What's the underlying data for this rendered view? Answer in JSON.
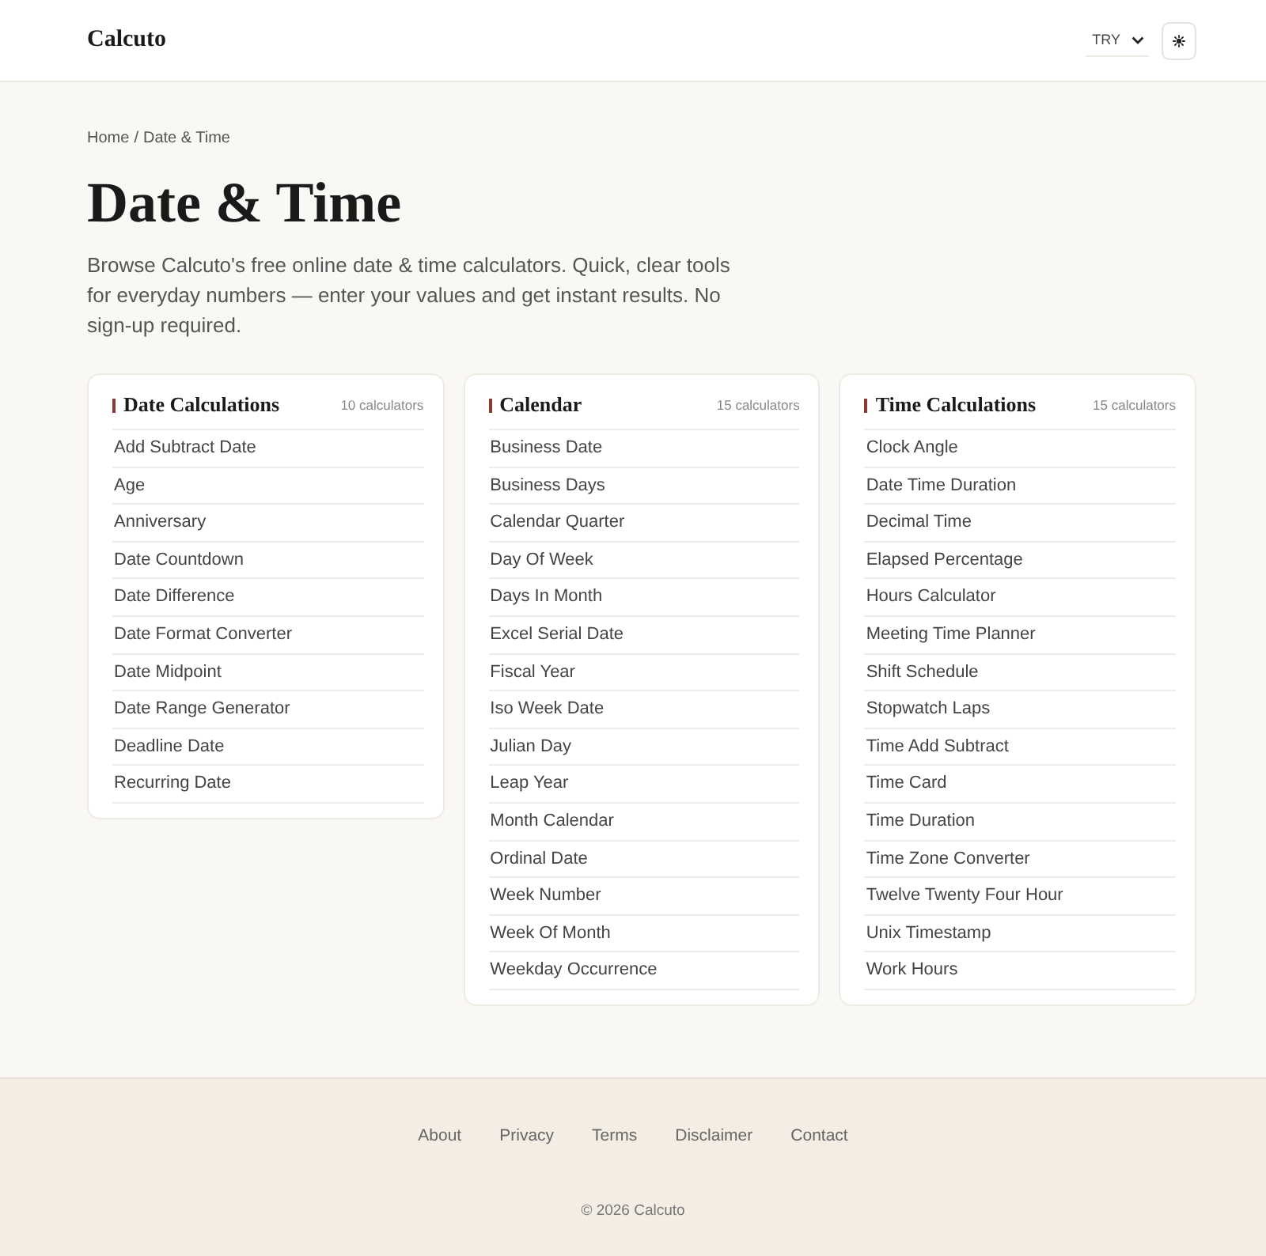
{
  "header": {
    "logo": "Calcuto",
    "currency": {
      "value": "TRY"
    }
  },
  "breadcrumb": {
    "items": [
      "Home",
      "Date & Time"
    ],
    "separator": "/"
  },
  "title": "Date & Time",
  "intro": "Browse Calcuto's free online date & time calculators. Quick, clear tools for everyday numbers — enter your values and get instant results. No sign-up required.",
  "categories": [
    {
      "title": "Date Calculations",
      "count": "10 calculators",
      "items": [
        "Add Subtract Date",
        "Age",
        "Anniversary",
        "Date Countdown",
        "Date Difference",
        "Date Format Converter",
        "Date Midpoint",
        "Date Range Generator",
        "Deadline Date",
        "Recurring Date"
      ]
    },
    {
      "title": "Calendar",
      "count": "15 calculators",
      "items": [
        "Business Date",
        "Business Days",
        "Calendar Quarter",
        "Day Of Week",
        "Days In Month",
        "Excel Serial Date",
        "Fiscal Year",
        "Iso Week Date",
        "Julian Day",
        "Leap Year",
        "Month Calendar",
        "Ordinal Date",
        "Week Number",
        "Week Of Month",
        "Weekday Occurrence"
      ]
    },
    {
      "title": "Time Calculations",
      "count": "15 calculators",
      "items": [
        "Clock Angle",
        "Date Time Duration",
        "Decimal Time",
        "Elapsed Percentage",
        "Hours Calculator",
        "Meeting Time Planner",
        "Shift Schedule",
        "Stopwatch Laps",
        "Time Add Subtract",
        "Time Card",
        "Time Duration",
        "Time Zone Converter",
        "Twelve Twenty Four Hour",
        "Unix Timestamp",
        "Work Hours"
      ]
    }
  ],
  "footer": {
    "links": [
      "About",
      "Privacy",
      "Terms",
      "Disclaimer",
      "Contact"
    ],
    "copyright": "© 2026 Calcuto"
  }
}
